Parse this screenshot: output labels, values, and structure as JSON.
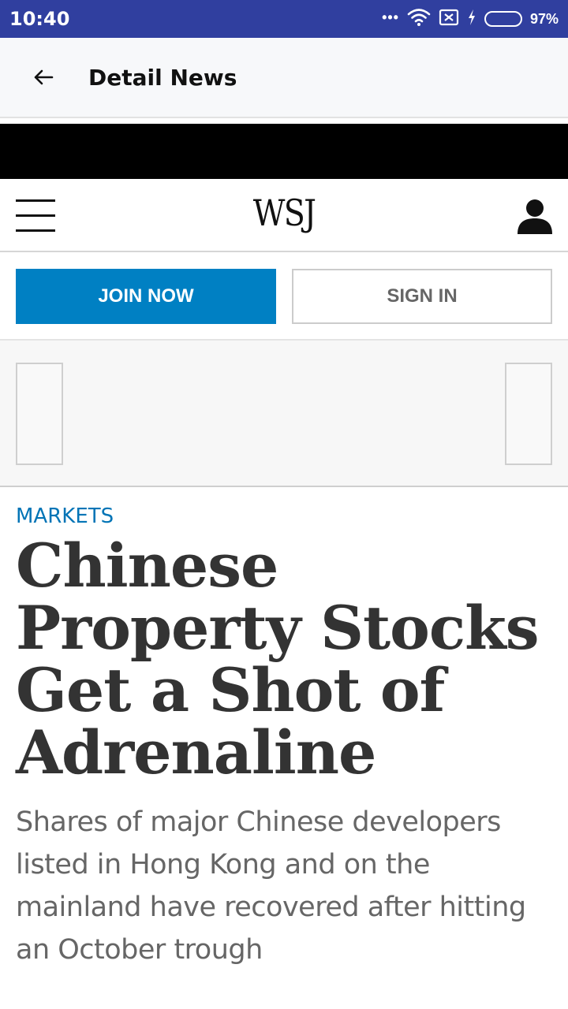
{
  "status_bar": {
    "time": "10:40",
    "dots": "•••",
    "battery": "97%",
    "icons": [
      "wifi-icon",
      "sim-off-icon",
      "charging-icon",
      "battery-icon"
    ]
  },
  "app_bar": {
    "back_icon": "arrow-left-icon",
    "title": "Detail News"
  },
  "wsj": {
    "logo": "WSJ",
    "menu_icon": "hamburger-menu-icon",
    "user_icon": "user-account-icon"
  },
  "actions": {
    "join": "JOIN NOW",
    "signin": "SIGN IN"
  },
  "article": {
    "section": "MARKETS",
    "headline": "Chinese Property Stocks Get a Shot of Adrenaline",
    "summary": "Shares of major Chinese developers listed in Hong Kong and on the mainland have recovered after hitting an October trough"
  },
  "colors": {
    "status_bar": "#303f9f",
    "join_button": "#0080c3",
    "section_label": "#0274b6",
    "battery": "#4caf50"
  }
}
